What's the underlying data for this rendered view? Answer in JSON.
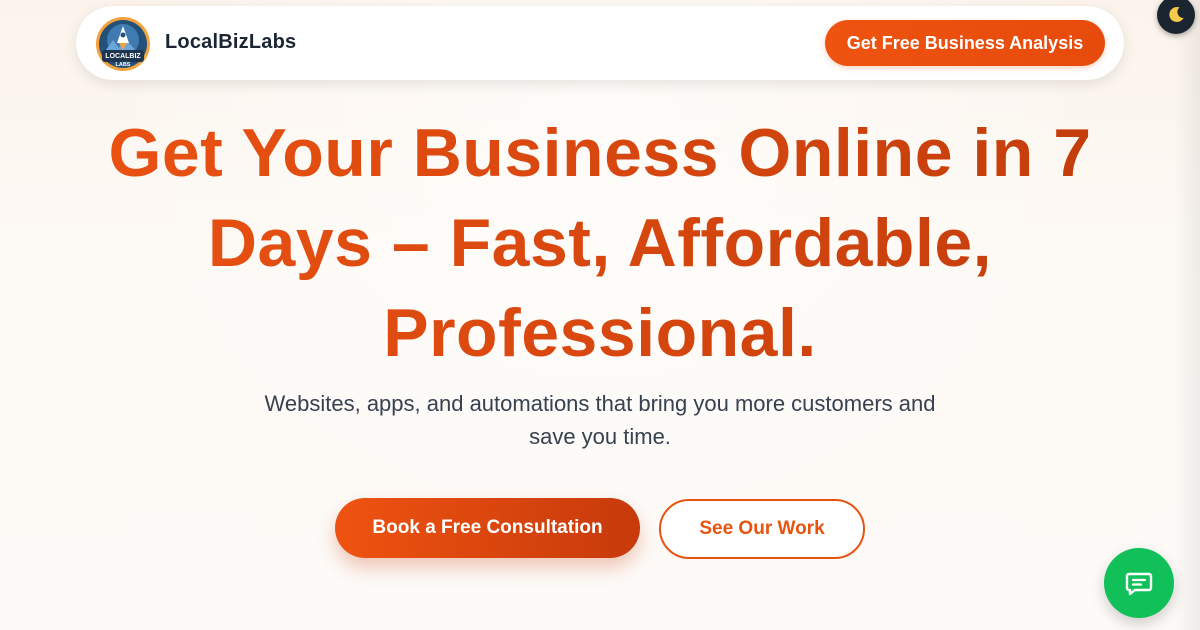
{
  "brand": {
    "name": "LocalBizLabs",
    "logo_text": "LOCALBIZ LABS"
  },
  "header": {
    "cta_label": "Get Free Business Analysis"
  },
  "hero": {
    "title_lines": [
      "Get Your Business Online in 7",
      "Days – Fast, Affordable,",
      "Professional."
    ],
    "subtitle_lines": [
      "Websites, apps, and automations that bring you more customers and",
      "save you time."
    ],
    "primary_cta": "Book a Free Consultation",
    "secondary_cta": "See Our Work"
  },
  "icons": {
    "theme_toggle": "moon-icon",
    "chat": "chat-bubble-icon"
  },
  "colors": {
    "accent": "#e8540f",
    "accent_dark": "#c13d0c",
    "chat_green": "#12c05a",
    "toggle_bg": "#1b2530",
    "text_dark": "#1c2533",
    "subtitle_text": "#364152"
  }
}
